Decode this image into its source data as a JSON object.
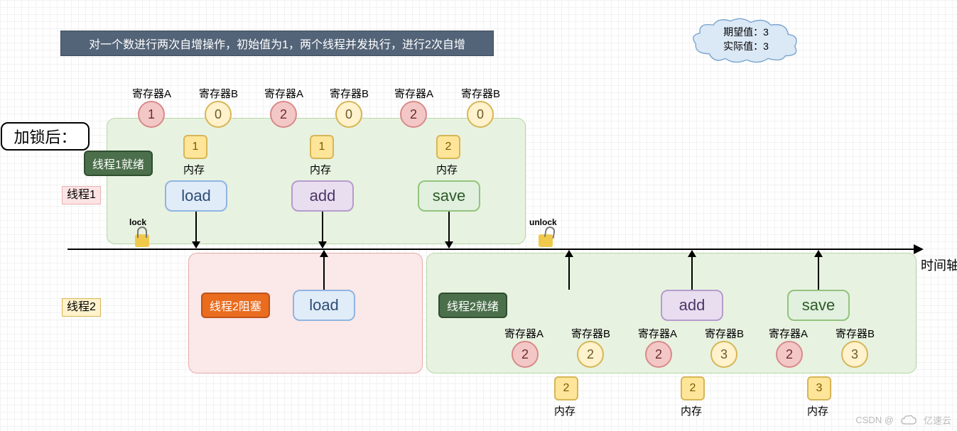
{
  "title": "对一个数进行两次自增操作，初始值为1，两个线程并发执行，进行2次自增",
  "after_lock": "加锁后：",
  "thread1_label": "线程1",
  "thread2_label": "线程2",
  "axis_label": "时间轴",
  "lock_label": "lock",
  "unlock_label": "unlock",
  "reg_a_label": "寄存器A",
  "reg_b_label": "寄存器B",
  "mem_label": "内存",
  "state": {
    "t1_ready": "线程1就绪",
    "t2_block": "线程2阻塞",
    "t2_ready": "线程2就绪"
  },
  "ops": {
    "load": "load",
    "add": "add",
    "save": "save"
  },
  "top_steps": [
    {
      "regA": "1",
      "regB": "0",
      "mem": "1",
      "op": "load"
    },
    {
      "regA": "2",
      "regB": "0",
      "mem": "1",
      "op": "add"
    },
    {
      "regA": "2",
      "regB": "0",
      "mem": "2",
      "op": "save"
    }
  ],
  "bottom_steps": [
    {
      "regA": "2",
      "regB": "2",
      "mem": "2"
    },
    {
      "regA": "2",
      "regB": "3",
      "mem": "2",
      "op": "add"
    },
    {
      "regA": "2",
      "regB": "3",
      "mem": "3",
      "op": "save"
    }
  ],
  "cloud": {
    "line1": "期望值：3",
    "line2": "实际值：3"
  },
  "watermark": {
    "left": "CSDN @",
    "right": "亿速云"
  }
}
